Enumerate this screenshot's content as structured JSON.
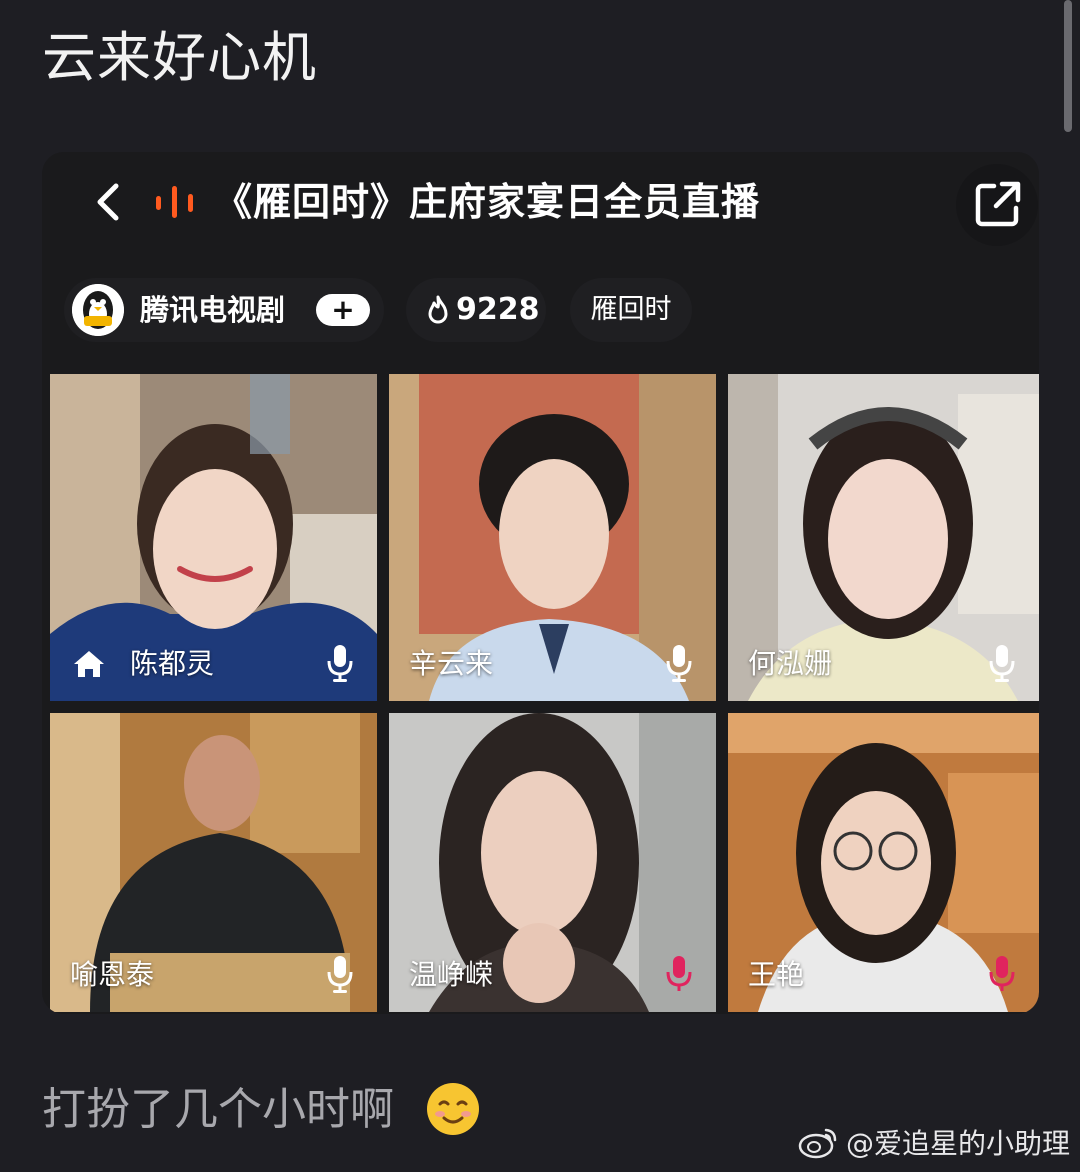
{
  "post": {
    "title": "云来好心机",
    "caption": "打扮了几个小时啊",
    "caption_emoji": "smiling-face-emoji",
    "watermark": "@爱追星的小助理",
    "watermark_icon": "weibo-icon"
  },
  "live": {
    "title": "《雁回时》庄府家宴日全员直播",
    "back_icon": "chevron-left-icon",
    "live_indicator_icon": "live-bars-icon",
    "share_icon": "share-external-icon",
    "accent_color": "#ff5a1f",
    "channel": {
      "name": "腾讯电视剧",
      "follow_label": "+",
      "avatar_icon": "penguin-avatar"
    },
    "heat": {
      "icon": "flame-icon",
      "value": "9228"
    },
    "tag": "雁回时"
  },
  "participants": [
    {
      "name": "陈都灵",
      "host": true,
      "mic": "on"
    },
    {
      "name": "辛云来",
      "host": false,
      "mic": "on"
    },
    {
      "name": "何泓姗",
      "host": false,
      "mic": "on"
    },
    {
      "name": "喻恩泰",
      "host": false,
      "mic": "on"
    },
    {
      "name": "温峥嵘",
      "host": false,
      "mic": "muted"
    },
    {
      "name": "王艳",
      "host": false,
      "mic": "muted"
    }
  ]
}
